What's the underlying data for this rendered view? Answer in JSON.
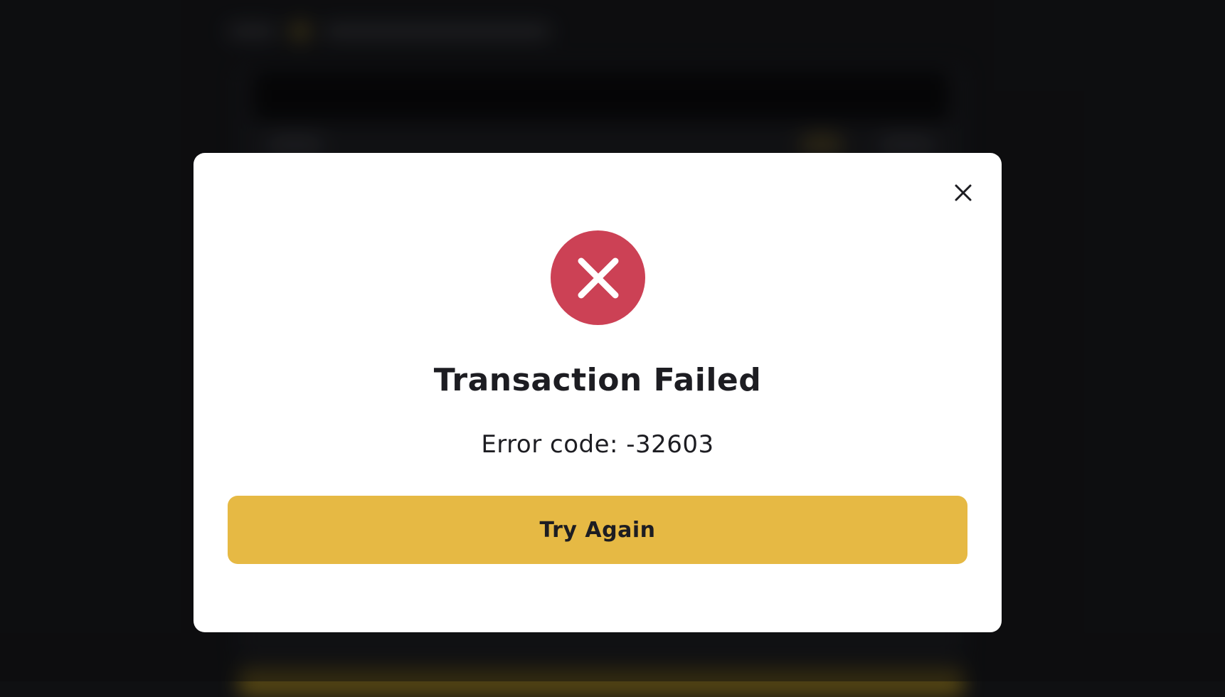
{
  "modal": {
    "title": "Transaction Failed",
    "error_code_text": "Error code: -32603",
    "try_again_label": "Try Again",
    "close_icon": "close-icon",
    "status_icon": "error-x-icon"
  },
  "colors": {
    "error_red": "#cc4155",
    "button_gold": "#e6b944",
    "text_dark": "#1d1d22",
    "page_background": "#0f1012"
  }
}
